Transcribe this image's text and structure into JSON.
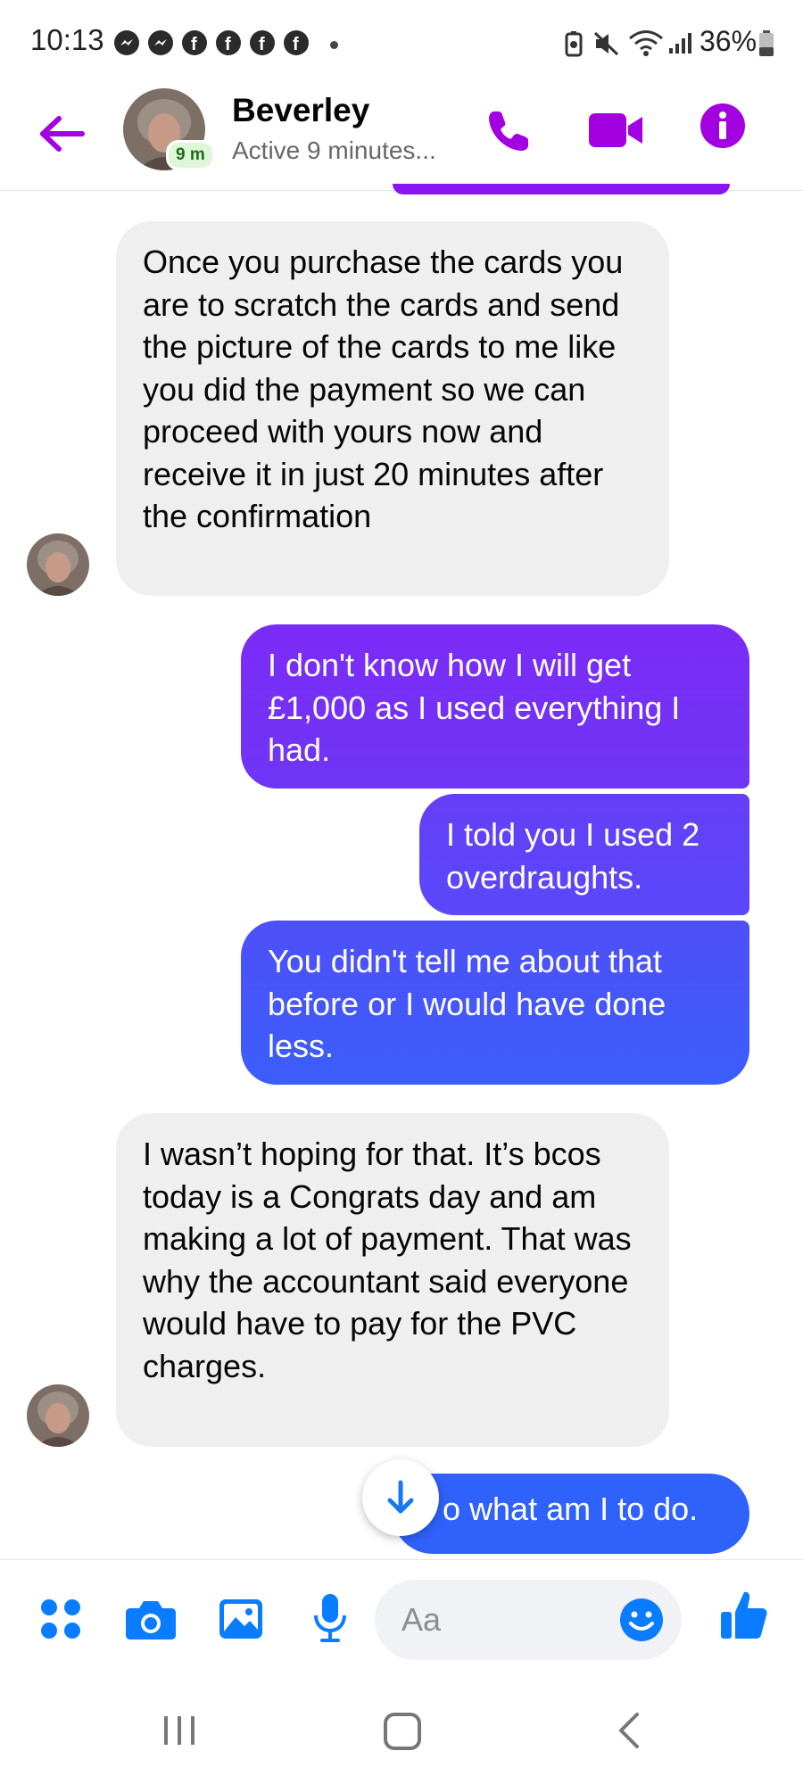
{
  "status_bar": {
    "time": "10:13",
    "battery": "36%"
  },
  "header": {
    "name": "Beverley",
    "status": "Active 9 minutes...",
    "active_badge": "9 m"
  },
  "messages": [
    {
      "direction": "incoming",
      "text": "Once you purchase the cards you are to scratch the cards and send the picture of the cards to me like you did the payment so we can proceed with yours now and receive it in just 20 minutes after the confirmation"
    },
    {
      "direction": "outgoing",
      "text": "I don't know how I will get £1,000 as I used everything I had."
    },
    {
      "direction": "outgoing",
      "text": "I told you I used 2 overdraughts."
    },
    {
      "direction": "outgoing",
      "text": "You didn't tell me about that before or I would have done less."
    },
    {
      "direction": "incoming",
      "text": "I wasn’t hoping for that. It’s bcos today is a Congrats day and am making a lot of payment. That was why the accountant said everyone would have to pay for the PVC charges."
    },
    {
      "direction": "outgoing",
      "text": "o what am I to do."
    }
  ],
  "composer": {
    "placeholder": "Aa"
  },
  "colors": {
    "accent": "#a200e0",
    "outgoing_top": "#7a2cf5",
    "outgoing_bottom": "#2e63fb",
    "incoming": "#efefef"
  }
}
